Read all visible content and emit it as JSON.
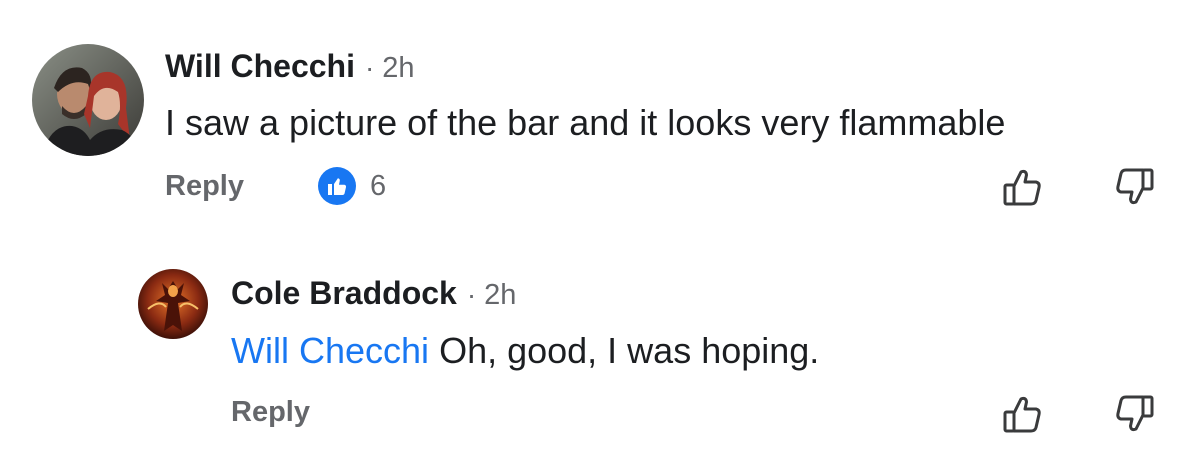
{
  "comments": [
    {
      "author": "Will Checchi",
      "time": "2h",
      "text": "I saw a picture of the bar and it looks very flammable",
      "reply_label": "Reply",
      "like_count": "6"
    },
    {
      "author": "Cole Braddock",
      "time": "2h",
      "mention": "Will Checchi",
      "text": "Oh, good, I was hoping.",
      "reply_label": "Reply"
    }
  ],
  "separator": "·",
  "colors": {
    "primary_text": "#1c1e21",
    "secondary_text": "#65676b",
    "link_blue": "#1877f2",
    "like_badge": "#1877f2"
  },
  "icons": {
    "like_badge": "thumbs-up-icon",
    "upvote": "thumbs-up-outline-icon",
    "downvote": "thumbs-down-outline-icon"
  }
}
